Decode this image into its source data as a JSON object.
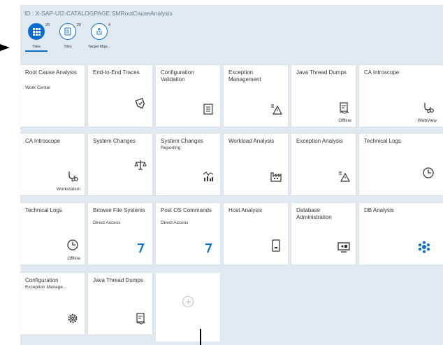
{
  "header": {
    "id_text": "ID : X-SAP-UI2-CATALOGPAGE:SMRootCauseAnalysis"
  },
  "view_tabs": [
    {
      "label": "Tiles",
      "count": "20",
      "icon": "grid-icon",
      "active": true
    },
    {
      "label": "Tiles",
      "count": "20",
      "icon": "list-icon",
      "active": false
    },
    {
      "label": "Target Map...",
      "count": "4",
      "icon": "export-icon",
      "active": false
    }
  ],
  "tiles": [
    {
      "title": "Root Cause Analysis",
      "subtitle": "Work Center",
      "icon": "",
      "footer": ""
    },
    {
      "title": "End-to-End Traces",
      "subtitle": "",
      "icon": "location-check-icon",
      "footer": ""
    },
    {
      "title": "Configuration Validation",
      "subtitle": "",
      "icon": "checklist-icon",
      "footer": ""
    },
    {
      "title": "Exception Management",
      "subtitle": "",
      "icon": "warning-list-icon",
      "footer": ""
    },
    {
      "title": "Java Thread Dumps",
      "subtitle": "",
      "icon": "document-icon",
      "footer": "Offline"
    },
    {
      "title": "CA Introscope",
      "subtitle": "",
      "icon": "stethoscope-icon",
      "footer": "WebView"
    },
    {
      "title": "CA Introscope",
      "subtitle": "",
      "icon": "stethoscope-icon",
      "footer": "Workstation"
    },
    {
      "title": "System Changes",
      "subtitle": "",
      "icon": "balance-icon",
      "footer": ""
    },
    {
      "title": "System Changes",
      "subtitle": "Reporting",
      "icon": "chart-icon",
      "footer": ""
    },
    {
      "title": "Workload Analysis",
      "subtitle": "",
      "icon": "factory-icon",
      "footer": ""
    },
    {
      "title": "Exception Analysis",
      "subtitle": "",
      "icon": "warning-list-icon",
      "footer": ""
    },
    {
      "title": "Technical Logs",
      "subtitle": "",
      "icon": "clock-icon",
      "footer": ""
    },
    {
      "title": "Technical Logs",
      "subtitle": "",
      "icon": "clock-icon",
      "footer": "Offline"
    },
    {
      "title": "Browse File Systems",
      "subtitle": "Direct Access",
      "icon": "refresh-arrow-icon",
      "footer": ""
    },
    {
      "title": "Post OS Commands",
      "subtitle": "Direct Access",
      "icon": "refresh-arrow-icon",
      "footer": ""
    },
    {
      "title": "Host Analysis",
      "subtitle": "",
      "icon": "tablet-icon",
      "footer": ""
    },
    {
      "title": "Database Administration",
      "subtitle": "",
      "icon": "monitor-icon",
      "footer": ""
    },
    {
      "title": "DB Analysis",
      "subtitle": "",
      "icon": "network-icon",
      "footer": ""
    },
    {
      "title": "Configuration",
      "subtitle": "Exception Manage...",
      "icon": "gear-icon",
      "footer": ""
    },
    {
      "title": "Java Thread Dumps",
      "subtitle": "",
      "icon": "document-icon",
      "footer": ""
    }
  ],
  "colors": {
    "accent": "#0a6ed1",
    "background": "#dfe9ef",
    "tile": "#ffffff",
    "text": "#32363a"
  }
}
